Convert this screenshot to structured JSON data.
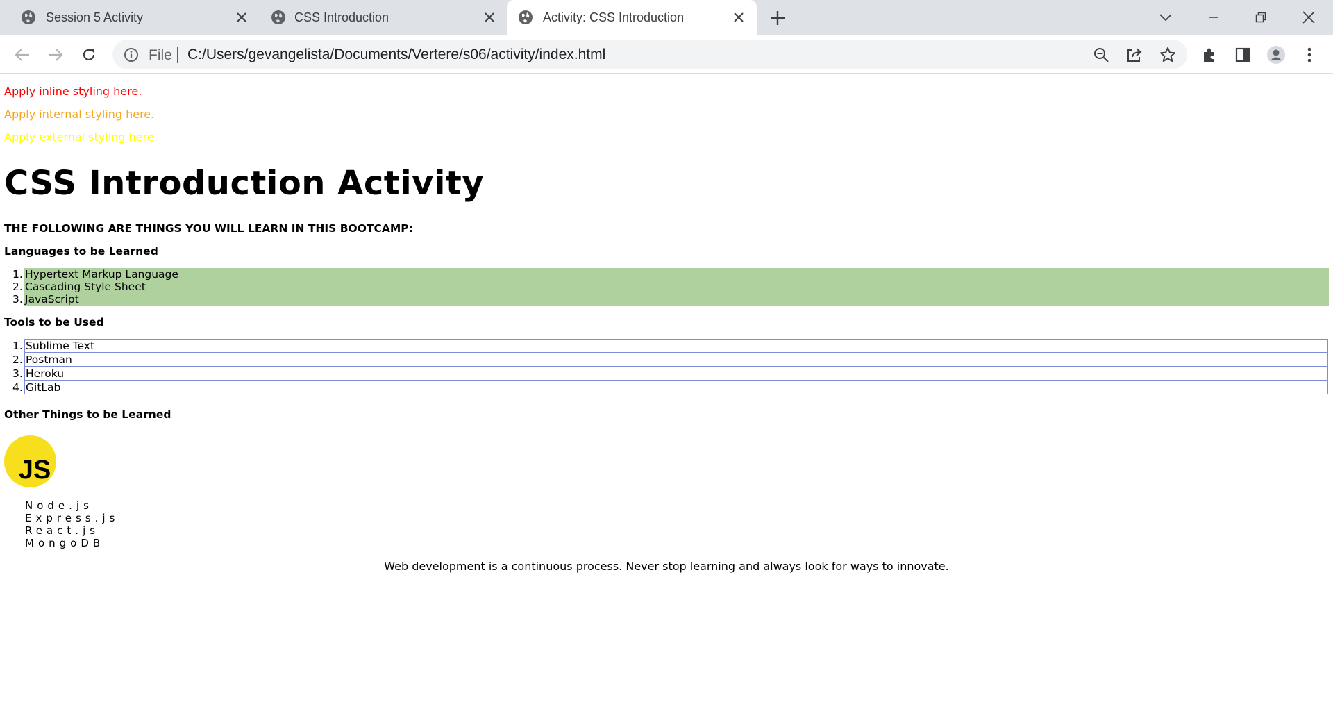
{
  "browser": {
    "tabs": [
      {
        "title": "Session 5 Activity",
        "active": false
      },
      {
        "title": "CSS Introduction",
        "active": false
      },
      {
        "title": "Activity: CSS Introduction",
        "active": true
      }
    ],
    "address": {
      "scheme_label": "File",
      "url": "C:/Users/gevangelista/Documents/Vertere/s06/activity/index.html"
    },
    "icons": [
      "globe-icon",
      "close-icon",
      "plus-icon",
      "chevron-down-icon",
      "minimize-icon",
      "restore-icon",
      "window-close-icon",
      "back-icon",
      "forward-icon",
      "reload-icon",
      "info-icon",
      "zoom-out-icon",
      "share-icon",
      "star-icon",
      "extensions-icon",
      "side-panel-icon",
      "profile-icon",
      "menu-icon"
    ]
  },
  "page": {
    "notes": {
      "inline": "Apply inline styling here.",
      "internal": "Apply internal styling here.",
      "external": "Apply external styling here."
    },
    "note_colors": {
      "inline": "#ff0000",
      "internal": "#f5a623",
      "external": "#ffff00"
    },
    "title": "CSS Introduction Activity",
    "intro_heading": "THE FOLLOWING ARE THINGS YOU WILL LEARN IN THIS BOOTCAMP:",
    "languages": {
      "heading": "Languages to be Learned",
      "items": [
        "Hypertext Markup Language",
        "Cascading Style Sheet",
        "JavaScript"
      ],
      "highlight_color": "#afd19e"
    },
    "tools": {
      "heading": "Tools to be Used",
      "items": [
        "Sublime Text",
        "Postman",
        "Heroku",
        "GitLab"
      ],
      "border_color": "#7e8bd6"
    },
    "other": {
      "heading": "Other Things to be Learned",
      "logo_text": "JS",
      "logo_color": "#f7df1e",
      "items": [
        "Node.js",
        "Express.js",
        "React.js",
        "MongoDB"
      ]
    },
    "footer": "Web development is a continuous process. Never stop learning and always look for ways to innovate."
  }
}
